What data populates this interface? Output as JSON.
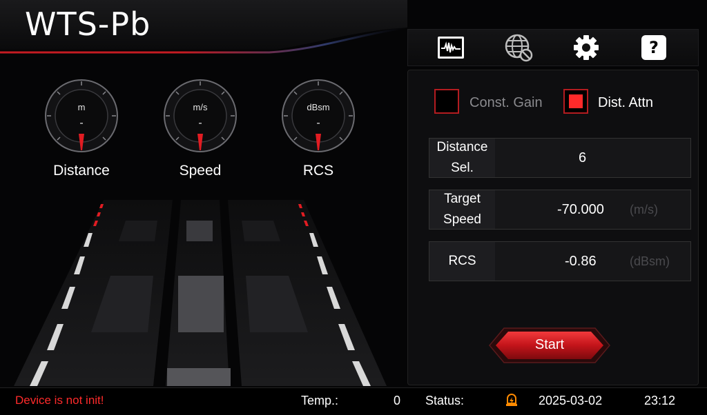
{
  "app": {
    "title": "WTS-Pb"
  },
  "gauges": [
    {
      "unit": "m",
      "value": "-",
      "label": "Distance"
    },
    {
      "unit": "m/s",
      "value": "-",
      "label": "Speed"
    },
    {
      "unit": "dBsm",
      "value": "-",
      "label": "RCS"
    }
  ],
  "toolbar": {
    "icons": [
      "waveform-monitor-icon",
      "network-disabled-icon",
      "gear-icon",
      "help-icon"
    ],
    "help_glyph": "?"
  },
  "mode": {
    "const_gain": {
      "label": "Const. Gain",
      "checked": false
    },
    "dist_attn": {
      "label": "Dist. Attn",
      "checked": true
    }
  },
  "fields": {
    "distance": {
      "label_line1": "Distance",
      "label_line2": "Sel.",
      "value": "6",
      "unit": ""
    },
    "speed": {
      "label_line1": "Target",
      "label_line2": "Speed",
      "value": "-70.000",
      "unit": "(m/s)"
    },
    "rcs": {
      "label_line1": "RCS",
      "label_line2": "",
      "value": "-0.86",
      "unit": "(dBsm)"
    }
  },
  "start_button": {
    "label": "Start"
  },
  "status": {
    "message": "Device is not init!",
    "temp_label": "Temp.:",
    "temp_value": "0",
    "status_label": "Status:",
    "date": "2025-03-02",
    "time": "23:12"
  },
  "colors": {
    "accent_red": "#e11c22",
    "error_text": "#ff2b2b",
    "status_icon": "#ff8a00"
  }
}
